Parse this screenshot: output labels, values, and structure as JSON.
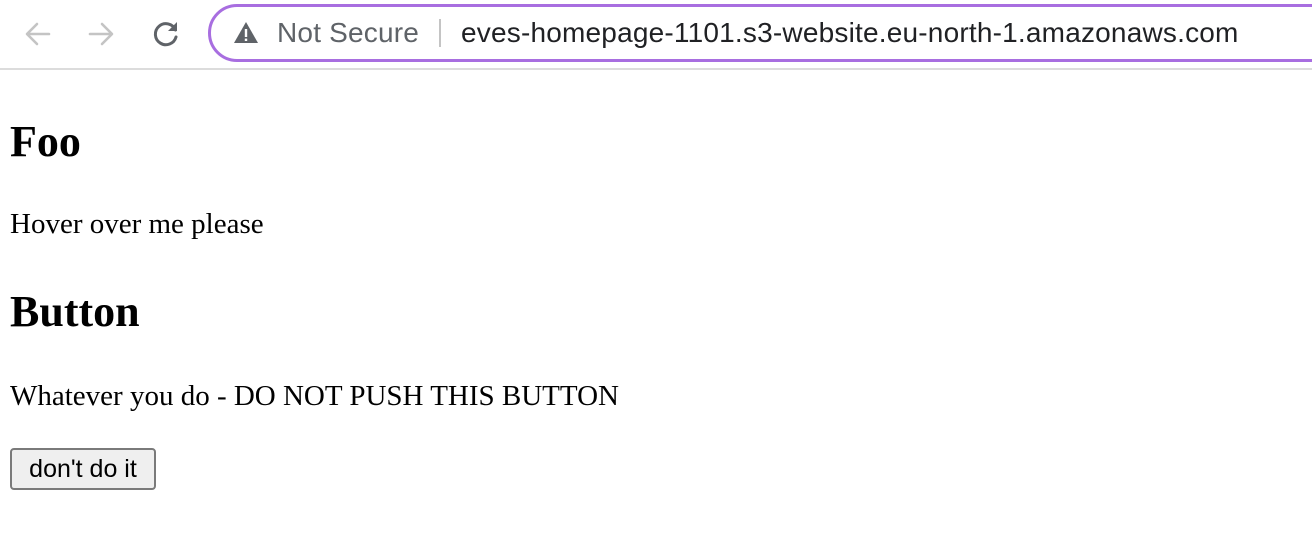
{
  "browser": {
    "nav": {
      "back_icon": "arrow-left-icon",
      "forward_icon": "arrow-right-icon",
      "reload_icon": "reload-icon"
    },
    "omnibox": {
      "security_icon": "warning-icon",
      "security_label": "Not Secure",
      "url": "eves-homepage-1101.s3-website.eu-north-1.amazonaws.com",
      "focus_ring_color": "#a86ee0"
    }
  },
  "page": {
    "heading_1": "Foo",
    "hover_text": "Hover over me please",
    "heading_2": "Button",
    "warning_text": "Whatever you do - DO NOT PUSH THIS BUTTON",
    "button_label": "don't do it"
  }
}
